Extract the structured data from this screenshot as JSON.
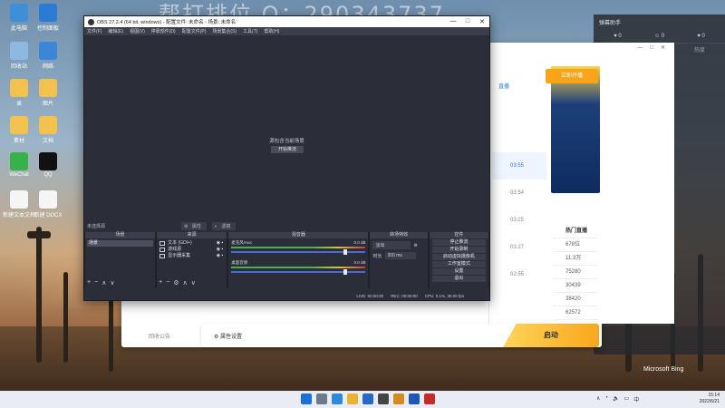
{
  "watermark": {
    "text": "帮打排位 Q：290343737"
  },
  "desktop": {
    "icons": [
      {
        "label": "此电脑",
        "color": "#3d8fd8"
      },
      {
        "label": "控制面板",
        "color": "#2a7bd2"
      },
      {
        "label": "回收站",
        "color": "#8fb8e0"
      },
      {
        "label": "网络",
        "color": "#3b86d6"
      },
      {
        "label": "录",
        "color": "#f2c14e"
      },
      {
        "label": "图片",
        "color": "#f2c14e"
      },
      {
        "label": "素材",
        "color": "#f2c14e"
      },
      {
        "label": "文档",
        "color": "#f2c14e"
      },
      {
        "label": "WeChat",
        "color": "#35b34a"
      },
      {
        "label": "QQ",
        "color": "#111111"
      },
      {
        "label": "新建文本文档",
        "color": "#f5f5f5"
      },
      {
        "label": "新建 DOCX",
        "color": "#f5f5f5"
      }
    ]
  },
  "right_panel": {
    "title": "弹幕助手",
    "stats": [
      "♥ 0",
      "☺ 0",
      "♥ 0"
    ],
    "labels": [
      "0",
      "关注",
      "热度"
    ]
  },
  "bg_app": {
    "banner_button": "立即开播",
    "tab_label": "直播",
    "times": [
      "03:55",
      "03:54",
      "03:25",
      "03:27",
      "02:55"
    ],
    "hot_header": "热门直播",
    "hot_values": [
      "678位",
      "11.3万",
      "75280",
      "30439",
      "38420",
      "62572"
    ],
    "collect_label": "回收公告",
    "properties_label": "属性设置",
    "start_label": "启动",
    "microsoft_bing": "Microsoft Bing"
  },
  "obs": {
    "title": "OBS 27.2.4 (64 bit, windows) - 配置文件: 未命名 - 场景: 未命名",
    "menu": [
      "文件(F)",
      "编辑(E)",
      "视图(V)",
      "停靠部件(D)",
      "配置文件(P)",
      "场景集合(S)",
      "工具(T)",
      "帮助(H)"
    ],
    "preview_message": "源包含当前场景",
    "preview_button": "开始推流",
    "source_bar_label": "未选择源",
    "props_button": "属性",
    "filters_button": "滤镜",
    "docks": {
      "scenes": "场景",
      "sources": "来源",
      "mixer": "混音器",
      "transitions": "转场特效",
      "controls": "控件"
    },
    "scene_items": [
      "场景"
    ],
    "source_items": [
      "文本 (GDI+)",
      "游戏源",
      "显示器采集"
    ],
    "mixer_tracks": [
      {
        "name": "麦克风/Aux",
        "db": "0.0 dB"
      },
      {
        "name": "桌面音频",
        "db": "0.0 dB"
      }
    ],
    "transition": {
      "selected": "淡出",
      "duration_label": "时长",
      "duration_value": "300 ms"
    },
    "control_buttons": [
      "停止推流",
      "开始录制",
      "启动虚拟摄像机",
      "工作室模式",
      "设置",
      "退出"
    ],
    "status": {
      "live": "LIVE: 00:00:00",
      "rec": "REC: 00:00:00",
      "cpu": "CPU: 0.1%, 30.00 fps"
    }
  },
  "taskbar": {
    "time": "15:14",
    "date": "2022/6/21",
    "lang": "中"
  }
}
